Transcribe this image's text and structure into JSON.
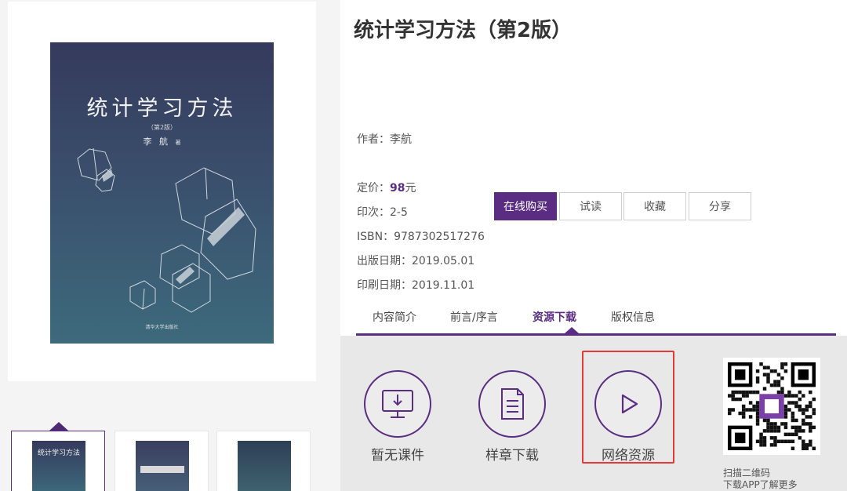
{
  "book": {
    "title": "统计学习方法（第2版）",
    "author_label": "作者：",
    "author": "李航",
    "price_label": "定价：",
    "price_value": "98",
    "price_unit": "元",
    "printing_label": "印次：",
    "printing": "2-5",
    "isbn_label": "ISBN：",
    "isbn": "9787302517276",
    "publish_date_label": "出版日期：",
    "publish_date": "2019.05.01",
    "print_date_label": "印刷日期：",
    "print_date": "2019.11.01"
  },
  "cover": {
    "title": "统计学习方法",
    "edition": "（第2版）",
    "author": "李 航",
    "author_suffix": "著",
    "publisher": "清华大学出版社"
  },
  "thumbnail_1_title": "统计学习方法",
  "actions": {
    "buy": "在线购买",
    "trial": "试读",
    "favorite": "收藏",
    "share": "分享"
  },
  "tabs": [
    {
      "label": "内容简介"
    },
    {
      "label": "前言/序言"
    },
    {
      "label": "资源下载"
    },
    {
      "label": "版权信息"
    }
  ],
  "resources": [
    {
      "label": "暂无课件",
      "icon": "monitor-download-icon"
    },
    {
      "label": "样章下载",
      "icon": "document-icon"
    },
    {
      "label": "网络资源",
      "icon": "play-icon"
    }
  ],
  "qr": {
    "caption_line1": "扫描二维码",
    "caption_line2": "下载APP了解更多"
  },
  "colors": {
    "accent": "#5a2d82",
    "highlight": "#e53935"
  }
}
